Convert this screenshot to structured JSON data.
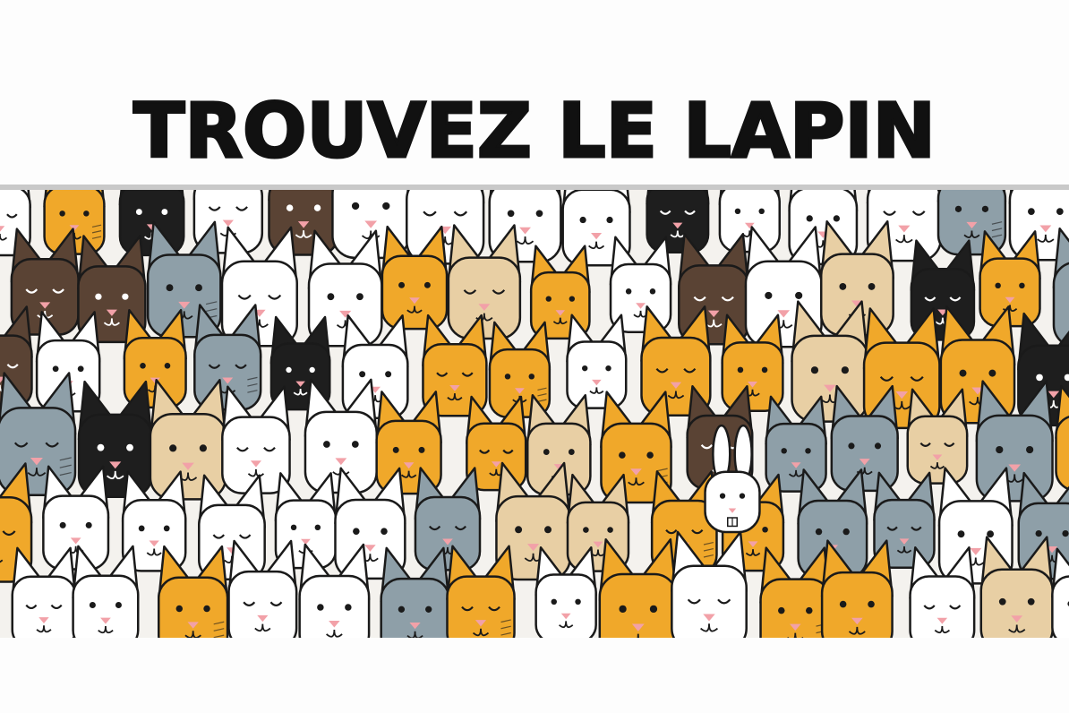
{
  "title": "TROUVEZ LE LAPIN",
  "colors": {
    "orange": "#f0a82a",
    "grey": "#8e9fa8",
    "white": "#ffffff",
    "brown": "#5a4334",
    "black": "#1e1e1e",
    "cream": "#e8cfa4",
    "outline": "#1a1a1a",
    "nose": "#f2a1a8"
  },
  "icons": [
    "cat-face-icon",
    "rabbit-face-icon"
  ]
}
